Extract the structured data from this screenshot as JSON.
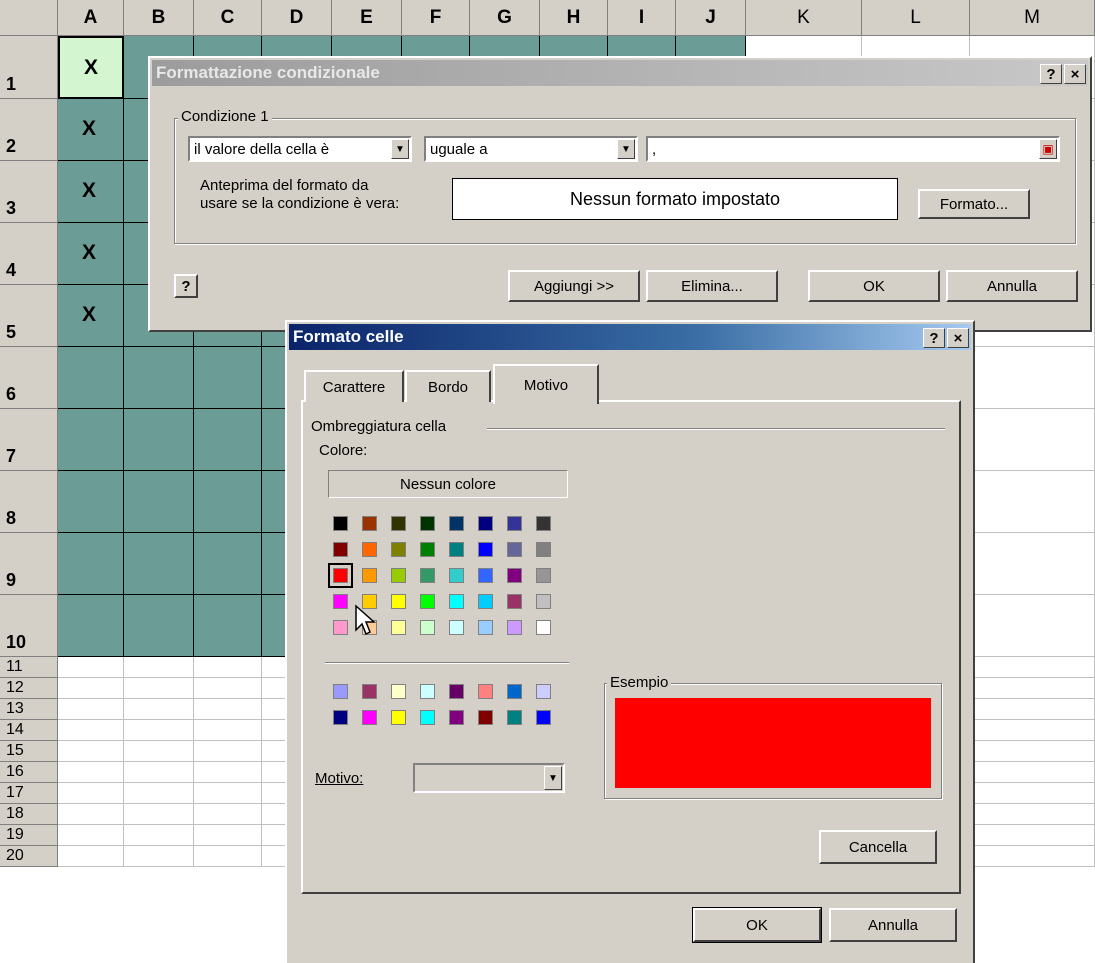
{
  "sheet": {
    "columns": [
      "A",
      "B",
      "C",
      "D",
      "E",
      "F",
      "G",
      "H",
      "I",
      "J",
      "K",
      "L",
      "M"
    ],
    "rows": [
      "1",
      "2",
      "3",
      "4",
      "5",
      "6",
      "7",
      "8",
      "9",
      "10",
      "11",
      "12",
      "13",
      "14",
      "15",
      "16",
      "17",
      "18",
      "19",
      "20"
    ],
    "cell_mark": "X"
  },
  "cf_dialog": {
    "title": "Formattazione condizionale",
    "help_btn": "?",
    "close_btn": "×",
    "group_label": "Condizione 1",
    "condition_type": "il valore della cella è",
    "operator": "uguale a",
    "value": ",",
    "preview_label_1": "Anteprima del formato da",
    "preview_label_2": "usare se la condizione è vera:",
    "preview_text": "Nessun formato impostato",
    "format_button": "Formato...",
    "add_button": "Aggiungi >>",
    "delete_button": "Elimina...",
    "ok_button": "OK",
    "cancel_button": "Annulla"
  },
  "fc_dialog": {
    "title": "Formato celle",
    "help_btn": "?",
    "close_btn": "×",
    "tabs": [
      "Carattere",
      "Bordo",
      "Motivo"
    ],
    "active_tab": "Motivo",
    "group_label": "Ombreggiatura cella",
    "color_label": "Colore:",
    "no_color_button": "Nessun colore",
    "palette": [
      [
        "#000000",
        "#993300",
        "#333300",
        "#003300",
        "#003366",
        "#000080",
        "#333399",
        "#333333"
      ],
      [
        "#800000",
        "#ff6600",
        "#808000",
        "#008000",
        "#008080",
        "#0000ff",
        "#666699",
        "#808080"
      ],
      [
        "#ff0000",
        "#ff9900",
        "#99cc00",
        "#339966",
        "#33cccc",
        "#3366ff",
        "#800080",
        "#969696"
      ],
      [
        "#ff00ff",
        "#ffcc00",
        "#ffff00",
        "#00ff00",
        "#00ffff",
        "#00ccff",
        "#993366",
        "#c0c0c0"
      ],
      [
        "#ff99cc",
        "#ffcc99",
        "#ffff99",
        "#ccffcc",
        "#ccffff",
        "#99ccff",
        "#cc99ff",
        "#ffffff"
      ]
    ],
    "palette_extra": [
      [
        "#9999ff",
        "#993366",
        "#ffffcc",
        "#ccffff",
        "#660066",
        "#ff8080",
        "#0066cc",
        "#ccccff"
      ],
      [
        "#000080",
        "#ff00ff",
        "#ffff00",
        "#00ffff",
        "#800080",
        "#800000",
        "#008080",
        "#0000ff"
      ]
    ],
    "selected_color": "#ff0000",
    "pattern_label": "Motivo:",
    "sample_label": "Esempio",
    "clear_button": "Cancella",
    "ok_button": "OK",
    "cancel_button": "Annulla"
  },
  "colors": {
    "teal_fill": "#6b9d96",
    "selected_cell": "#d3f5cf"
  }
}
